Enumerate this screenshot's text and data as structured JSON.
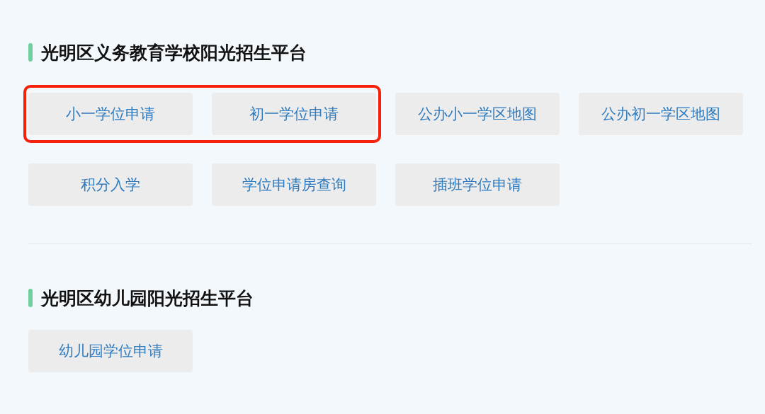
{
  "sections": [
    {
      "title": "光明区义务教育学校阳光招生平台",
      "button_groups": [
        {
          "highlighted": true,
          "buttons": [
            "小一学位申请",
            "初一学位申请"
          ]
        },
        {
          "highlighted": false,
          "buttons": [
            "公办小一学区地图",
            "公办初一学区地图"
          ]
        },
        {
          "highlighted": false,
          "buttons": [
            "积分入学",
            "学位申请房查询",
            "插班学位申请"
          ]
        }
      ]
    },
    {
      "title": "光明区幼儿园阳光招生平台",
      "button_groups": [
        {
          "highlighted": false,
          "buttons": [
            "幼儿园学位申请"
          ]
        }
      ]
    }
  ]
}
